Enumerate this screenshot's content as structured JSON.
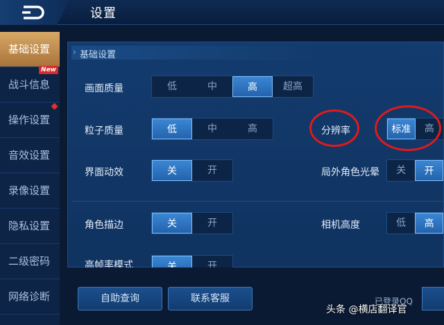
{
  "header": {
    "title": "设置",
    "back_icon": "back-arrow-icon"
  },
  "sidebar": {
    "items": [
      {
        "label": "基础设置",
        "active": true
      },
      {
        "label": "战斗信息",
        "badge": "New"
      },
      {
        "label": "操作设置",
        "dot": true
      },
      {
        "label": "音效设置"
      },
      {
        "label": "录像设置"
      },
      {
        "label": "隐私设置"
      },
      {
        "label": "二级密码"
      },
      {
        "label": "网络诊断"
      }
    ]
  },
  "section": {
    "title": "基础设置"
  },
  "settings": {
    "quality": {
      "label": "画面质量",
      "options": [
        "低",
        "中",
        "高",
        "超高"
      ],
      "selected": "高"
    },
    "particle": {
      "label": "粒子质量",
      "options": [
        "低",
        "中",
        "高"
      ],
      "selected": "低"
    },
    "ui_anim": {
      "label": "界面动效",
      "options": [
        "关",
        "开"
      ],
      "selected": "关"
    },
    "outline": {
      "label": "角色描边",
      "options": [
        "关",
        "开"
      ],
      "selected": "关"
    },
    "hfr": {
      "label": "高帧率模式",
      "options": [
        "关",
        "开"
      ],
      "selected": "关"
    },
    "resolution": {
      "label": "分辨率",
      "options": [
        "标准",
        "高"
      ],
      "selected": "标准"
    },
    "halo": {
      "label": "局外角色光晕",
      "options": [
        "关",
        "开"
      ],
      "selected": "开"
    },
    "camera": {
      "label": "相机高度",
      "options": [
        "低",
        "高"
      ],
      "selected": "高"
    }
  },
  "footer": {
    "help_button": "自助查询",
    "service_button": "联系客服",
    "login_status": "已登录QQ"
  },
  "watermark": "头条 @横店翻译官",
  "colors": {
    "highlight": "#e01a1a",
    "selected": "#2f7bd0",
    "active_tab": "#c8944f"
  }
}
